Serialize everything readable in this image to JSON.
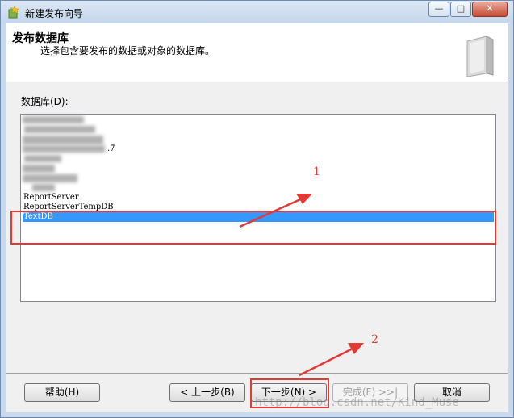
{
  "window": {
    "title": "新建发布向导",
    "min_glyph": "—",
    "max_glyph": "□",
    "close_glyph": "✕"
  },
  "header": {
    "title": "发布数据库",
    "subtitle": "选择包含要发布的数据或对象的数据库。"
  },
  "database_list": {
    "label": "数据库(D):",
    "partial_tail": ".7",
    "items": [
      "ReportServer",
      "ReportServerTempDB",
      "TextDB"
    ],
    "selected": "TextDB"
  },
  "annotations": {
    "label_1": "1",
    "label_2": "2",
    "color": "#e53935"
  },
  "buttons": {
    "help": "帮助(H)",
    "back": "< 上一步(B)",
    "next": "下一步(N) >",
    "finish": "完成(F) >>|",
    "cancel": "取消"
  },
  "watermark": "http://blog.csdn.net/Kind_Muse"
}
